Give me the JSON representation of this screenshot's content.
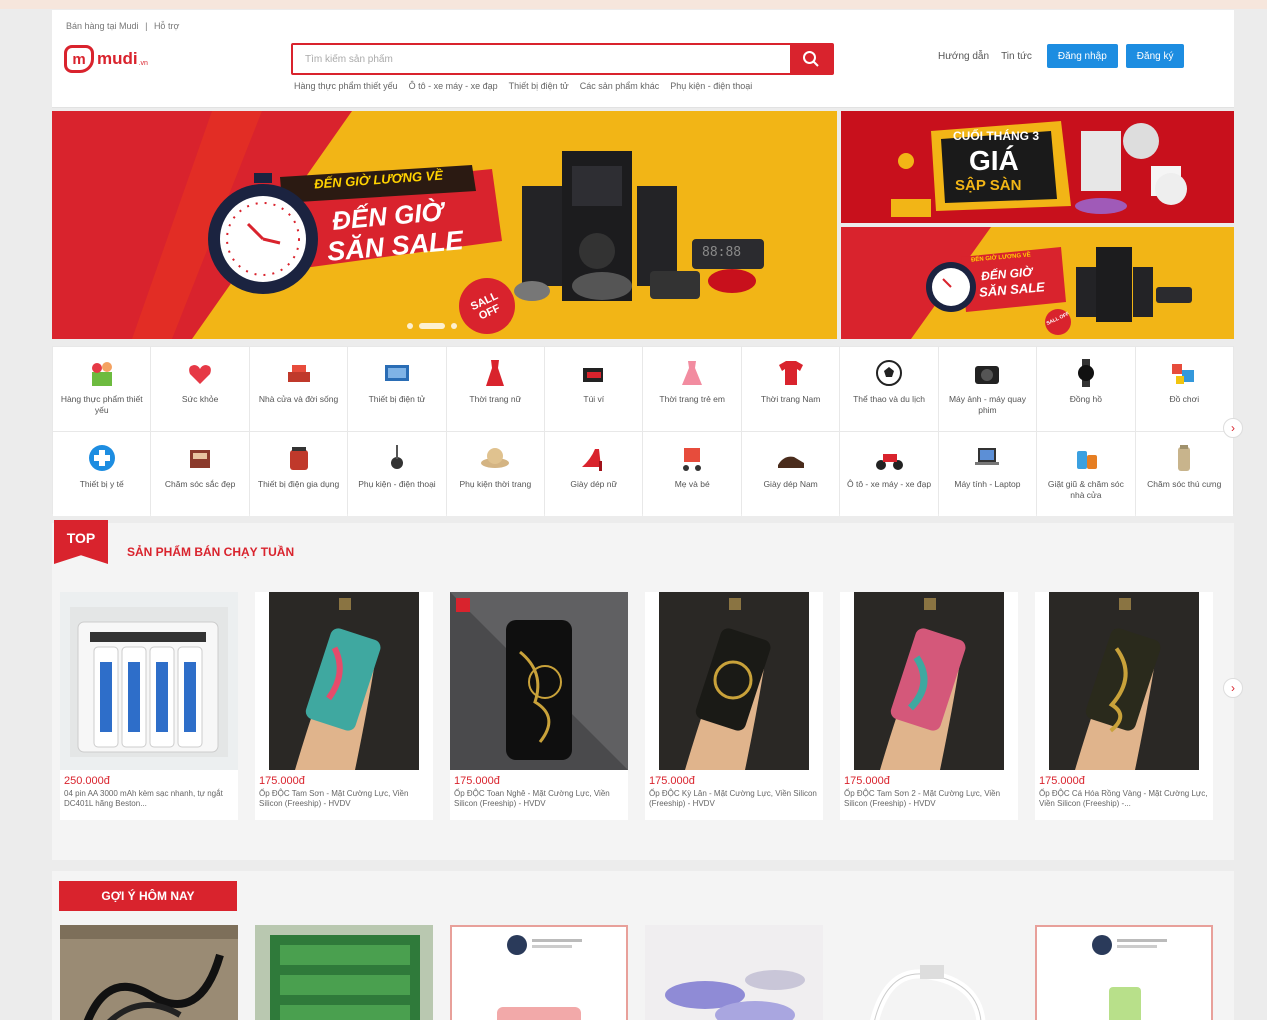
{
  "header": {
    "top_links": [
      "Bán hàng tại Mudi",
      "|",
      "Hỗ trợ"
    ],
    "logo_text": "mudi",
    "logo_sub": ".vn",
    "search_placeholder": "Tìm kiếm sản phẩm",
    "quick_links": [
      "Hàng thực phẩm thiết yếu",
      "Ô tô - xe máy - xe đạp",
      "Thiết bị điện tử",
      "Các sản phẩm khác",
      "Phụ kiện - điện thoại"
    ],
    "nav_guide": "Hướng dẫn",
    "nav_news": "Tin tức",
    "login": "Đăng nhập",
    "register": "Đăng ký"
  },
  "banners": {
    "main_line1": "ĐẾN GIỜ LƯƠNG VỀ",
    "main_line2": "ĐẾN GIỜ",
    "main_line3": "SĂN SALE",
    "main_badge": "SALL OFF",
    "clock_digits": "88:88",
    "side1_line1": "CUỐI THÁNG 3",
    "side1_line2": "GIÁ",
    "side1_line3": "SẬP SÀN",
    "side2_line1": "ĐẾN GIỜ LƯƠNG VỀ",
    "side2_line2": "ĐẾN GIỜ",
    "side2_line3": "SĂN SALE",
    "side2_badge": "SALL OFF"
  },
  "categories": [
    {
      "label": "Hàng thực phẩm thiết yếu",
      "icon": "grocery-basket-icon"
    },
    {
      "label": "Sức khỏe",
      "icon": "health-icon"
    },
    {
      "label": "Nhà cửa và đời sống",
      "icon": "home-living-icon"
    },
    {
      "label": "Thiết bị điện tử",
      "icon": "electronics-icon"
    },
    {
      "label": "Thời trang nữ",
      "icon": "dress-icon"
    },
    {
      "label": "Túi ví",
      "icon": "bag-icon"
    },
    {
      "label": "Thời trang trẻ em",
      "icon": "kids-dress-icon"
    },
    {
      "label": "Thời trang Nam",
      "icon": "shirt-icon"
    },
    {
      "label": "Thể thao và du lịch",
      "icon": "football-icon"
    },
    {
      "label": "Máy ảnh - máy quay phim",
      "icon": "camera-icon"
    },
    {
      "label": "Đồng hồ",
      "icon": "watch-icon"
    },
    {
      "label": "Đồ chơi",
      "icon": "toy-icon"
    },
    {
      "label": "Thiết bị y tế",
      "icon": "medical-icon"
    },
    {
      "label": "Chăm sóc sắc đẹp",
      "icon": "beauty-icon"
    },
    {
      "label": "Thiết bị điện gia dụng",
      "icon": "kettle-icon"
    },
    {
      "label": "Phụ kiện - điện thoại",
      "icon": "earphone-icon"
    },
    {
      "label": "Phụ kiện thời trang",
      "icon": "hat-icon"
    },
    {
      "label": "Giày dép nữ",
      "icon": "heels-icon"
    },
    {
      "label": "Mẹ và bé",
      "icon": "stroller-icon"
    },
    {
      "label": "Giày dép Nam",
      "icon": "men-shoes-icon"
    },
    {
      "label": "Ô tô - xe máy - xe đạp",
      "icon": "motorbike-icon"
    },
    {
      "label": "Máy tính - Laptop",
      "icon": "laptop-icon"
    },
    {
      "label": "Giặt giũ & chăm sóc nhà cửa",
      "icon": "detergent-icon"
    },
    {
      "label": "Chăm sóc thú cưng",
      "icon": "pet-icon"
    }
  ],
  "top_section": {
    "tag": "TOP",
    "title": "SẢN PHẨM BÁN CHẠY TUẦN",
    "products": [
      {
        "price": "250.000đ",
        "name": "04 pin AA 3000 mAh kèm sạc nhanh, tự ngắt DC401L hãng Beston..."
      },
      {
        "price": "175.000đ",
        "name": "Ốp ĐỘC Tam Sơn - Mặt Cường Lực, Viền Silicon (Freeship) - HVDV"
      },
      {
        "price": "175.000đ",
        "name": "Ốp ĐỘC Toan Nghê - Mặt Cường Lực, Viền Silicon (Freeship) - HVDV"
      },
      {
        "price": "175.000đ",
        "name": "Ốp ĐỘC Kỳ Lân - Mặt Cường Lực, Viền Silicon (Freeship) - HVDV"
      },
      {
        "price": "175.000đ",
        "name": "Ốp ĐỘC Tam Sơn 2 - Mặt Cường Lực, Viền Silicon (Freeship) - HVDV"
      },
      {
        "price": "175.000đ",
        "name": "Ốp ĐỘC Cá Hóa Rồng Vàng - Mặt Cường Lực, Viền Silicon (Freeship) -..."
      }
    ]
  },
  "suggest": {
    "title": "GỢI Ý HÔM NAY"
  },
  "colors": {
    "brand_red": "#d9232d",
    "blue": "#1d8de1",
    "yellow": "#f2b516"
  }
}
